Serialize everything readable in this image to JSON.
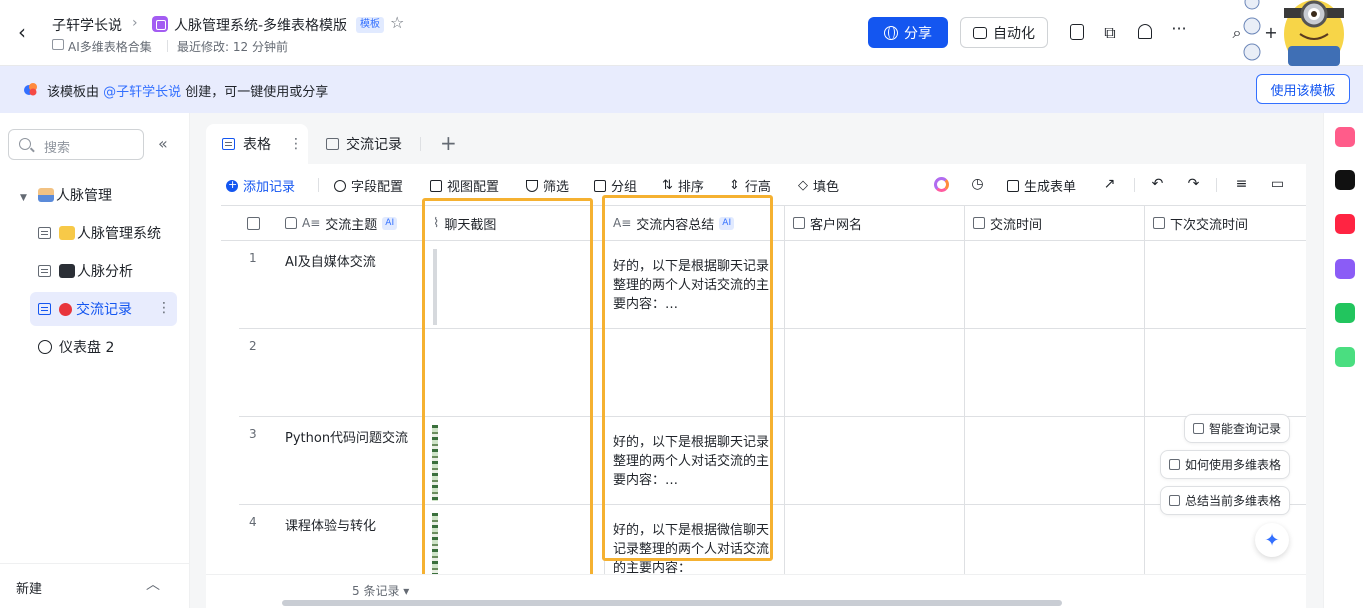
{
  "header": {
    "parent": "子轩学长说",
    "separator": "›",
    "title": "人脉管理系统-多维表格模版",
    "badge": "模板",
    "folder": "AI多维表格合集",
    "modified": "最近修改: 12 分钟前",
    "share": "分享",
    "automation": "自动化",
    "more": "···"
  },
  "banner": {
    "prefix": "该模板由 ",
    "author": "@子轩学长说",
    "suffix": " 创建，可一键使用或分享",
    "use_button": "使用该模板"
  },
  "sidebar": {
    "search_placeholder": "搜索",
    "items": [
      {
        "label": "人脉管理"
      },
      {
        "label": "人脉管理系统"
      },
      {
        "label": "人脉分析"
      },
      {
        "label": "交流记录"
      },
      {
        "label": "仪表盘 2"
      }
    ],
    "new_label": "新建"
  },
  "tabs": [
    {
      "label": "表格"
    },
    {
      "label": "交流记录"
    }
  ],
  "toolbar": {
    "add": "添加记录",
    "fields": "字段配置",
    "views": "视图配置",
    "filter": "筛选",
    "group": "分组",
    "sort": "排序",
    "row_height": "行高",
    "fill": "填色",
    "form": "生成表单"
  },
  "columns": [
    {
      "label": "交流主题",
      "ai": "AI"
    },
    {
      "label": "聊天截图"
    },
    {
      "label": "交流内容总结",
      "ai": "AI"
    },
    {
      "label": "客户网名"
    },
    {
      "label": "交流时间"
    },
    {
      "label": "下次交流时间"
    }
  ],
  "rows": [
    {
      "num": "1",
      "topic": "AI及自媒体交流",
      "summary": "好的，以下是根据聊天记录整理的两个人对话交流的主要内容：…"
    },
    {
      "num": "2",
      "topic": "",
      "summary": ""
    },
    {
      "num": "3",
      "topic": "Python代码问题交流",
      "summary": "好的，以下是根据聊天记录整理的两个人对话交流的主要内容：…"
    },
    {
      "num": "4",
      "topic": "课程体验与转化",
      "summary": "好的，以下是根据微信聊天记录整理的两个人对话交流的主要内容："
    }
  ],
  "footer": {
    "count": "5 条记录 ▾"
  },
  "ai_assist": {
    "query": "智能查询记录",
    "howto": "如何使用多维表格",
    "summarize": "总结当前多维表格"
  }
}
